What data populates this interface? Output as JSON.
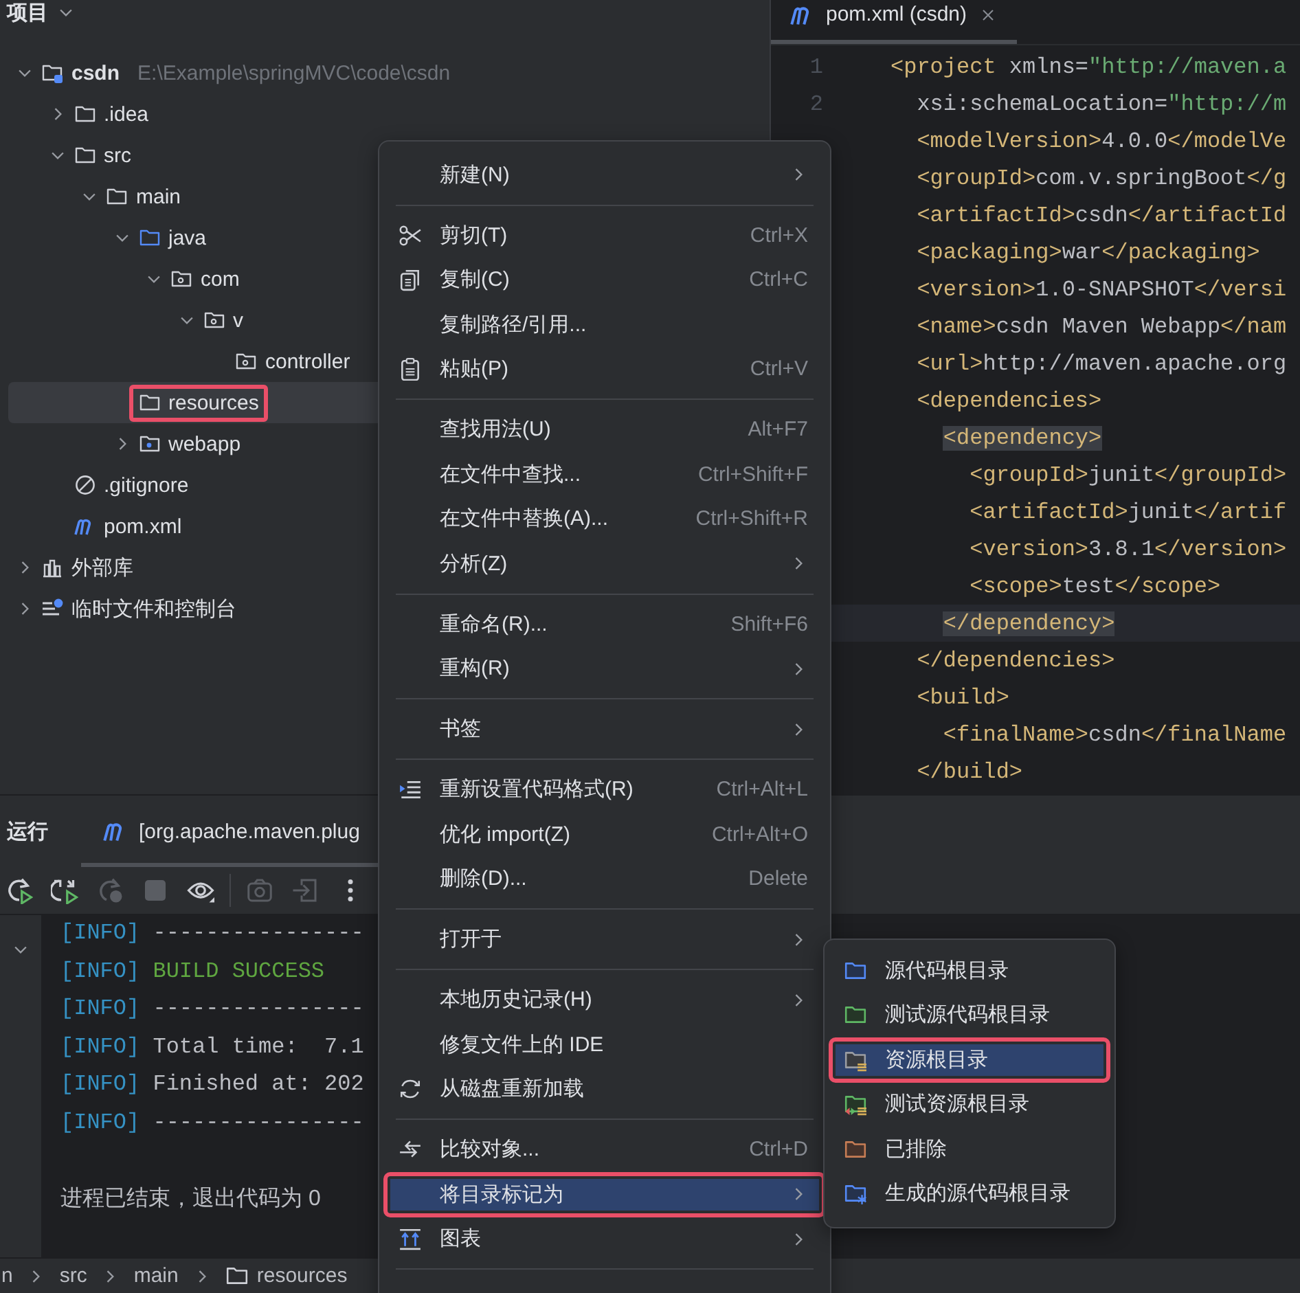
{
  "project_panel": {
    "title": "项目",
    "tree": [
      {
        "label": "csdn",
        "path": "E:\\Example\\springMVC\\code\\csdn",
        "kind": "module",
        "expanded": true,
        "selected": false,
        "outlined": false,
        "children": [
          {
            "label": ".idea",
            "kind": "folder",
            "expanded": false,
            "selected": false,
            "outlined": false
          },
          {
            "label": "src",
            "kind": "folder",
            "expanded": true,
            "selected": false,
            "outlined": false,
            "children": [
              {
                "label": "main",
                "kind": "folder",
                "expanded": true,
                "selected": false,
                "outlined": false,
                "children": [
                  {
                    "label": "java",
                    "kind": "source",
                    "expanded": true,
                    "selected": false,
                    "outlined": false,
                    "children": [
                      {
                        "label": "com",
                        "kind": "package",
                        "expanded": true,
                        "selected": false,
                        "outlined": false,
                        "children": [
                          {
                            "label": "v",
                            "kind": "package",
                            "expanded": true,
                            "selected": false,
                            "outlined": false,
                            "children": [
                              {
                                "label": "controller",
                                "kind": "package",
                                "selected": false,
                                "outlined": false
                              }
                            ]
                          }
                        ]
                      }
                    ]
                  },
                  {
                    "label": "resources",
                    "kind": "folder",
                    "selected": true,
                    "outlined": true
                  },
                  {
                    "label": "webapp",
                    "kind": "web",
                    "expanded": false,
                    "selected": false,
                    "outlined": false
                  }
                ]
              }
            ]
          },
          {
            "label": ".gitignore",
            "kind": "ignore",
            "selected": false,
            "outlined": false
          },
          {
            "label": "pom.xml",
            "kind": "m",
            "selected": false,
            "outlined": false
          }
        ]
      },
      {
        "label": "外部库",
        "kind": "library",
        "expanded": false,
        "selected": false,
        "outlined": false
      },
      {
        "label": "临时文件和控制台",
        "kind": "scratch",
        "expanded": false,
        "selected": false,
        "outlined": false
      }
    ]
  },
  "editor": {
    "tabs": [
      {
        "label": "pom.xml (csdn)",
        "selected": true
      }
    ],
    "lines": [
      {
        "number": "1",
        "text": "<project xmlns=\"http://maven.a",
        "highlight": false,
        "current": false
      },
      {
        "number": "2",
        "text": "  xsi:schemaLocation=\"http://m",
        "highlight": false,
        "current": false
      },
      {
        "text": "  <modelVersion>4.0.0</modelVe",
        "highlight": false,
        "current": false
      },
      {
        "text": "  <groupId>com.v.springBoot</g",
        "highlight": false,
        "current": false
      },
      {
        "text": "  <artifactId>csdn</artifactId",
        "highlight": false,
        "current": false
      },
      {
        "text": "  <packaging>war</packaging>",
        "highlight": false,
        "current": false
      },
      {
        "text": "  <version>1.0-SNAPSHOT</versi",
        "highlight": false,
        "current": false
      },
      {
        "text": "  <name>csdn Maven Webapp</nam",
        "highlight": false,
        "current": false
      },
      {
        "text": "  <url>http://maven.apache.org",
        "highlight": false,
        "current": false
      },
      {
        "text": "  <dependencies>",
        "highlight": false,
        "current": false
      },
      {
        "text": "    <dependency>",
        "highlight": true,
        "current": false
      },
      {
        "text": "      <groupId>junit</groupId>",
        "highlight": false,
        "current": false
      },
      {
        "text": "      <artifactId>junit</artif",
        "highlight": false,
        "current": false
      },
      {
        "text": "      <version>3.8.1</version>",
        "highlight": false,
        "current": false
      },
      {
        "text": "      <scope>test</scope>",
        "highlight": false,
        "current": false
      },
      {
        "text": "    </dependency>",
        "highlight": true,
        "current": true
      },
      {
        "text": "  </dependencies>",
        "highlight": false,
        "current": false
      },
      {
        "text": "  <build>",
        "highlight": false,
        "current": false
      },
      {
        "text": "    <finalName>csdn</finalName",
        "highlight": false,
        "current": false
      },
      {
        "text": "  </build>",
        "highlight": false,
        "current": false
      }
    ]
  },
  "run_panel": {
    "title": "运行",
    "tabs": [
      {
        "label": "[org.apache.maven.plug",
        "selected": true
      }
    ],
    "toolbar": [
      {
        "kind": "rerun",
        "disabled": false
      },
      {
        "kind": "rerun-failed",
        "disabled": false
      },
      {
        "kind": "rerun-alt",
        "disabled": true
      },
      {
        "kind": "stop",
        "disabled": true
      },
      {
        "kind": "eye",
        "disabled": false
      },
      {
        "kind": "separator"
      },
      {
        "kind": "camera",
        "disabled": true
      },
      {
        "kind": "exit",
        "disabled": true
      },
      {
        "kind": "more",
        "disabled": false
      }
    ],
    "console": [
      {
        "kind": "info",
        "text": "[INFO] ----------------"
      },
      {
        "kind": "success",
        "text": "[INFO] BUILD SUCCESS"
      },
      {
        "kind": "info",
        "text": "[INFO] ----------------"
      },
      {
        "kind": "info",
        "text": "[INFO] Total time:  7.1"
      },
      {
        "kind": "info",
        "text": "[INFO] Finished at: 202"
      },
      {
        "kind": "info",
        "text": "[INFO] ----------------"
      },
      {
        "kind": "exit",
        "text": "进程已结束，退出代码为 0"
      }
    ]
  },
  "status_bar": {
    "breadcrumbs": [
      {
        "label": "n",
        "kind": "text"
      },
      {
        "label": "src",
        "kind": "text"
      },
      {
        "label": "main",
        "kind": "text"
      },
      {
        "label": "resources",
        "kind": "folder"
      }
    ]
  },
  "context_menu": {
    "items": [
      {
        "kind": "item",
        "label": "新建(N)",
        "submenu": true,
        "selected": false,
        "outlined": false
      },
      {
        "kind": "separator"
      },
      {
        "kind": "scissors",
        "label": "剪切(T)",
        "shortcut": "Ctrl+X",
        "submenu": false,
        "selected": false,
        "outlined": false
      },
      {
        "kind": "copy",
        "label": "复制(C)",
        "shortcut": "Ctrl+C",
        "submenu": false,
        "selected": false,
        "outlined": false
      },
      {
        "kind": "item",
        "label": "复制路径/引用...",
        "submenu": false,
        "selected": false,
        "outlined": false
      },
      {
        "kind": "paste",
        "label": "粘贴(P)",
        "shortcut": "Ctrl+V",
        "submenu": false,
        "selected": false,
        "outlined": false
      },
      {
        "kind": "separator"
      },
      {
        "kind": "item",
        "label": "查找用法(U)",
        "shortcut": "Alt+F7",
        "submenu": false,
        "selected": false,
        "outlined": false
      },
      {
        "kind": "item",
        "label": "在文件中查找...",
        "shortcut": "Ctrl+Shift+F",
        "submenu": false,
        "selected": false,
        "outlined": false
      },
      {
        "kind": "item",
        "label": "在文件中替换(A)...",
        "shortcut": "Ctrl+Shift+R",
        "submenu": false,
        "selected": false,
        "outlined": false
      },
      {
        "kind": "item",
        "label": "分析(Z)",
        "submenu": true,
        "selected": false,
        "outlined": false
      },
      {
        "kind": "separator"
      },
      {
        "kind": "item",
        "label": "重命名(R)...",
        "shortcut": "Shift+F6",
        "submenu": false,
        "selected": false,
        "outlined": false
      },
      {
        "kind": "item",
        "label": "重构(R)",
        "submenu": true,
        "selected": false,
        "outlined": false
      },
      {
        "kind": "separator"
      },
      {
        "kind": "item",
        "label": "书签",
        "submenu": true,
        "selected": false,
        "outlined": false
      },
      {
        "kind": "separator"
      },
      {
        "kind": "reformat",
        "label": "重新设置代码格式(R)",
        "shortcut": "Ctrl+Alt+L",
        "submenu": false,
        "selected": false,
        "outlined": false
      },
      {
        "kind": "item",
        "label": "优化 import(Z)",
        "shortcut": "Ctrl+Alt+O",
        "submenu": false,
        "selected": false,
        "outlined": false
      },
      {
        "kind": "item",
        "label": "删除(D)...",
        "shortcut": "Delete",
        "submenu": false,
        "selected": false,
        "outlined": false
      },
      {
        "kind": "separator"
      },
      {
        "kind": "item",
        "label": "打开于",
        "submenu": true,
        "selected": false,
        "outlined": false
      },
      {
        "kind": "separator"
      },
      {
        "kind": "item",
        "label": "本地历史记录(H)",
        "submenu": true,
        "selected": false,
        "outlined": false
      },
      {
        "kind": "item",
        "label": "修复文件上的 IDE",
        "submenu": false,
        "selected": false,
        "outlined": false
      },
      {
        "kind": "reload",
        "label": "从磁盘重新加载",
        "submenu": false,
        "selected": false,
        "outlined": false
      },
      {
        "kind": "separator"
      },
      {
        "kind": "compare",
        "label": "比较对象...",
        "shortcut": "Ctrl+D",
        "submenu": false,
        "selected": false,
        "outlined": false
      },
      {
        "kind": "item",
        "label": "将目录标记为",
        "submenu": true,
        "selected": true,
        "outlined": true
      },
      {
        "kind": "diagram",
        "label": "图表",
        "submenu": true,
        "selected": false,
        "outlined": false
      },
      {
        "kind": "separator"
      }
    ]
  },
  "submenu": {
    "items": [
      {
        "label": "源代码根目录",
        "kind": "source-root",
        "selected": false,
        "outlined": false
      },
      {
        "label": "测试源代码根目录",
        "kind": "test-root",
        "selected": false,
        "outlined": false
      },
      {
        "label": "资源根目录",
        "kind": "resource-root",
        "selected": true,
        "outlined": true
      },
      {
        "label": "测试资源根目录",
        "kind": "test-resource-root",
        "selected": false,
        "outlined": false
      },
      {
        "label": "已排除",
        "kind": "excluded",
        "selected": false,
        "outlined": false
      },
      {
        "label": "生成的源代码根目录",
        "kind": "generated-root",
        "selected": false,
        "outlined": false
      }
    ]
  }
}
